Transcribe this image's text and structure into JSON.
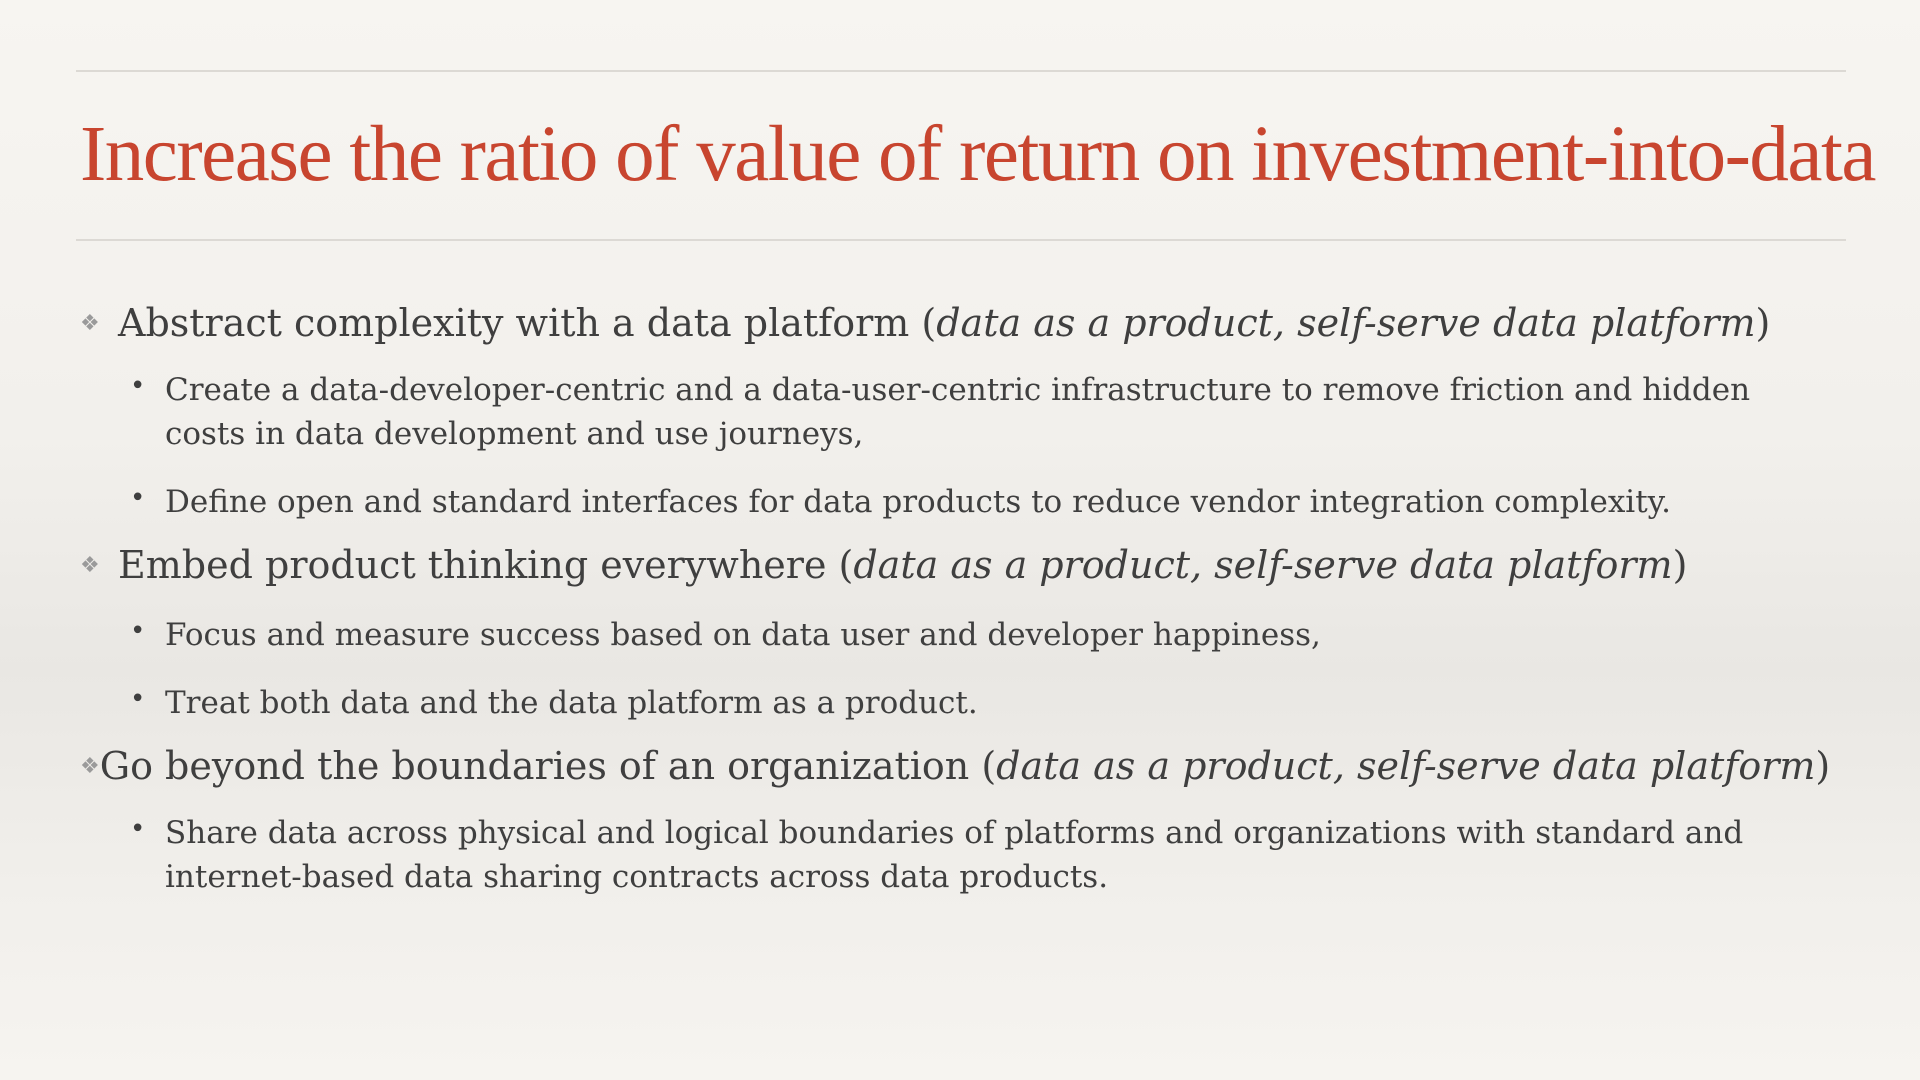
{
  "slide": {
    "title": "Increase the ratio of value of return on investment-into-data",
    "topics": [
      {
        "lead": "Abstract complexity with a data platform (",
        "italic": "data as a product, self-serve data platform",
        "close": ")",
        "bullets": [
          "Create a data-developer-centric and a data-user-centric infrastructure to remove friction and hidden costs in data development and use journeys,",
          "Define open and standard interfaces for data products to reduce vendor integration complexity."
        ]
      },
      {
        "lead": "Embed product thinking everywhere (",
        "italic": "data as a product, self-serve data platform",
        "close": ")",
        "bullets": [
          "Focus and measure success based on data user and developer happiness,",
          "Treat both data and the data platform as a product."
        ]
      },
      {
        "lead": "Go beyond the boundaries of an organization (",
        "italic": "data as a product, self-serve data platform",
        "close": ")",
        "bullets": [
          "Share data across physical and logical boundaries of platforms and organizations with standard and internet-based data sharing contracts across data products."
        ]
      }
    ]
  },
  "markers": {
    "topic_marker": "❖",
    "bullet_marker": "•"
  },
  "colors": {
    "title": "#c8452f",
    "text": "#3f3f3f",
    "rule": "#dcd9d4",
    "marker": "#9a9a9a"
  }
}
